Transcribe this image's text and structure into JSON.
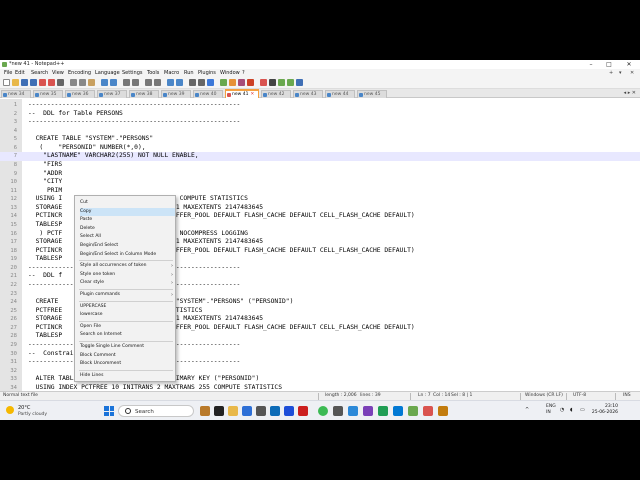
{
  "window": {
    "title": "*new 41 - Notepad++",
    "controls": [
      "–",
      "□",
      "✕"
    ]
  },
  "menu": {
    "items": [
      "File",
      "Edit",
      "Search",
      "View",
      "Encoding",
      "Language",
      "Settings",
      "Tools",
      "Macro",
      "Run",
      "Plugins",
      "Window",
      "?"
    ],
    "right": [
      "+",
      "▾",
      "✕"
    ]
  },
  "tabs": [
    {
      "label": "new 34",
      "active": false
    },
    {
      "label": "new 35",
      "active": false
    },
    {
      "label": "new 36",
      "active": false
    },
    {
      "label": "new 37",
      "active": false
    },
    {
      "label": "new 38",
      "active": false
    },
    {
      "label": "new 39",
      "active": false
    },
    {
      "label": "new 40",
      "active": false
    },
    {
      "label": "new 41",
      "active": true
    },
    {
      "label": "new 42",
      "active": false
    },
    {
      "label": "new 43",
      "active": false
    },
    {
      "label": "new 44",
      "active": false
    },
    {
      "label": "new 45",
      "active": false
    }
  ],
  "tab_nav": "◂ ▸ ✕",
  "editor": {
    "lines": [
      {
        "n": "1",
        "text": "--------------------------------------------------------"
      },
      {
        "n": "2",
        "text": "--  DDL for Table PERSONS"
      },
      {
        "n": "3",
        "text": "--------------------------------------------------------"
      },
      {
        "n": "4",
        "text": ""
      },
      {
        "n": "5",
        "text": "  CREATE TABLE \"SYSTEM\".\"PERSONS\""
      },
      {
        "n": "6",
        "text": "   (    \"PERSONID\" NUMBER(*,0),"
      },
      {
        "n": "7",
        "text": "    \"LASTNAME\" VARCHAR2(255) NOT NULL ENABLE,"
      },
      {
        "n": "8",
        "text": "    \"FIRS"
      },
      {
        "n": "9",
        "text": "    \"ADDR"
      },
      {
        "n": "10",
        "text": "    \"CITY"
      },
      {
        "n": "11",
        "text": "     PRIM"
      },
      {
        "n": "12",
        "text": "  USING I                2 MAXTRANS 255 COMPUTE STATISTICS"
      },
      {
        "n": "13",
        "text": "  STORAGE                76 MINEXTENTS 1 MAXEXTENTS 2147483645"
      },
      {
        "n": "14",
        "text": "  PCTINCR                ST GROUPS 1 BUFFER_POOL DEFAULT FLASH_CACHE DEFAULT CELL_FLASH_CACHE DEFAULT)"
      },
      {
        "n": "15",
        "text": "  TABLESP"
      },
      {
        "n": "16",
        "text": "   ) PCTF                1 MAXTRANS 255 NOCOMPRESS LOGGING"
      },
      {
        "n": "17",
        "text": "  STORAGE                76 MINEXTENTS 1 MAXEXTENTS 2147483645"
      },
      {
        "n": "18",
        "text": "  PCTINCR                ST GROUPS 1 BUFFER_POOL DEFAULT FLASH_CACHE DEFAULT CELL_FLASH_CACHE DEFAULT)"
      },
      {
        "n": "19",
        "text": "  TABLESP"
      },
      {
        "n": "20",
        "text": "--------------------------------------------------------"
      },
      {
        "n": "21",
        "text": "--  DDL f"
      },
      {
        "n": "22",
        "text": "--------------------------------------------------------"
      },
      {
        "n": "23",
        "text": ""
      },
      {
        "n": "24",
        "text": "  CREATE                 S_C007224\" ON \"SYSTEM\".\"PERSONS\" (\"PERSONID\")"
      },
      {
        "n": "25",
        "text": "  PCTFREE                55 COMPUTE STATISTICS"
      },
      {
        "n": "26",
        "text": "  STORAGE                76 MINEXTENTS 1 MAXEXTENTS 2147483645"
      },
      {
        "n": "27",
        "text": "  PCTINCR                ST GROUPS 1 BUFFER_POOL DEFAULT FLASH_CACHE DEFAULT CELL_FLASH_CACHE DEFAULT)"
      },
      {
        "n": "28",
        "text": "  TABLESP"
      },
      {
        "n": "29",
        "text": "--------------------------------------------------------"
      },
      {
        "n": "30",
        "text": "--  Constraints for Table PERSONS"
      },
      {
        "n": "31",
        "text": "--------------------------------------------------------"
      },
      {
        "n": "32",
        "text": ""
      },
      {
        "n": "33",
        "text": "  ALTER TABLE \"SYSTEM\".\"PERSONS\" ADD PRIMARY KEY (\"PERSONID\")"
      },
      {
        "n": "34",
        "text": "  USING INDEX PCTFREE 10 INITRANS 2 MAXTRANS 255 COMPUTE STATISTICS"
      }
    ]
  },
  "context_menu": {
    "items": [
      {
        "label": "Cut",
        "sub": false
      },
      {
        "label": "Copy",
        "sub": false,
        "hover": true
      },
      {
        "label": "Paste",
        "sub": false
      },
      {
        "label": "Delete",
        "sub": false
      },
      {
        "label": "Select All",
        "sub": false
      },
      {
        "label": "Begin/End Select",
        "sub": false
      },
      {
        "label": "Begin/End Select in Column Mode",
        "sub": false,
        "sep_after": true
      },
      {
        "label": "Style all occurrences of token",
        "sub": true
      },
      {
        "label": "Style one token",
        "sub": true
      },
      {
        "label": "Clear style",
        "sub": true,
        "sep_after": true
      },
      {
        "label": "Plugin commands",
        "sub": true,
        "sep_after": true
      },
      {
        "label": "UPPERCASE",
        "sub": false
      },
      {
        "label": "lowercase",
        "sub": false,
        "sep_after": true
      },
      {
        "label": "Open File",
        "sub": false
      },
      {
        "label": "Search on Internet",
        "sub": false,
        "sep_after": true
      },
      {
        "label": "Toggle Single Line Comment",
        "sub": false
      },
      {
        "label": "Block Comment",
        "sub": false
      },
      {
        "label": "Block Uncomment",
        "sub": false,
        "sep_after": true
      },
      {
        "label": "Hide Lines",
        "sub": false
      }
    ]
  },
  "status": {
    "file_type": "Normal text file",
    "length": "length : 2,006",
    "lines": "lines : 39",
    "ln": "Ln : 7",
    "col": "Col : 14",
    "sel": "Sel : 8 | 1",
    "eol": "Windows (CR LF)",
    "encoding": "UTF-8",
    "mode": "INS"
  },
  "taskbar": {
    "weather_temp": "20°C",
    "weather_cond": "Partly cloudy",
    "search_placeholder": "Search",
    "tray_lang": "ENG",
    "tray_region": "IN",
    "time": "23:10",
    "date": "25-06-2026"
  },
  "colors": {
    "active_tab_accent": "#f4a040",
    "current_line": "#e8e8ff",
    "menu_hover": "#cce4f7"
  }
}
